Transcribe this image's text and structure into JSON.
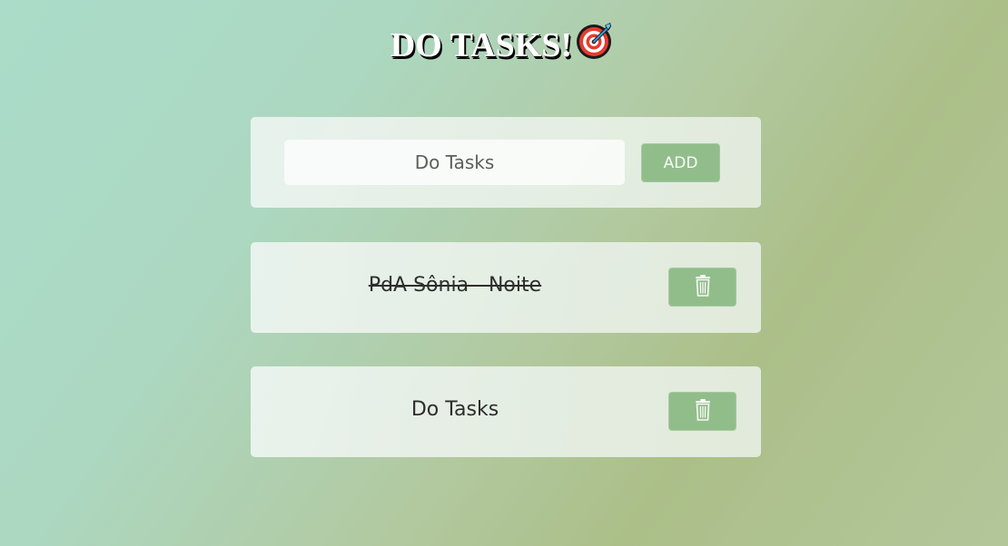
{
  "header": {
    "title": "DO TASKS!",
    "title_icon": "target-icon"
  },
  "input_form": {
    "placeholder": "Do Tasks",
    "value": "",
    "add_label": "ADD"
  },
  "tasks": [
    {
      "text": "PdA Sônia - Noite",
      "completed": true,
      "delete_icon": "trash-icon"
    },
    {
      "text": "Do Tasks",
      "completed": false,
      "delete_icon": "trash-icon"
    }
  ],
  "colors": {
    "button_green": "#8fbd8a",
    "card_bg": "#eef5f1",
    "title_text": "#ffffff"
  }
}
